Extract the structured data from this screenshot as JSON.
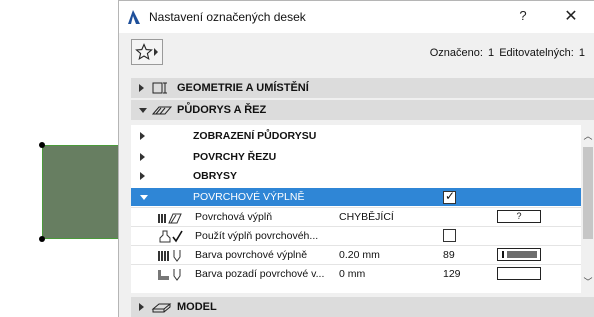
{
  "window": {
    "title": "Nastavení označených desek",
    "help_label": "?",
    "close_label": "✕"
  },
  "toolbar": {
    "selection_label": "Označeno:",
    "selection_count": "1",
    "editable_label": "Editovatelných:",
    "editable_count": "1"
  },
  "panels": [
    {
      "label": "GEOMETRIE A UMÍSTĚNÍ",
      "icon": "geometry-icon",
      "expanded": false
    },
    {
      "label": "PŮDORYS A ŘEZ",
      "icon": "floorplan-section-icon",
      "expanded": true
    },
    {
      "label": "MODEL",
      "icon": "model-icon",
      "expanded": false
    }
  ],
  "tree": {
    "groups": [
      {
        "label": "ZOBRAZENÍ PŮDORYSU"
      },
      {
        "label": "POVRCHY ŘEZU"
      },
      {
        "label": "OBRYSY"
      },
      {
        "label": "POVRCHOVÉ VÝPLNĚ",
        "checked": true
      }
    ],
    "rows": [
      {
        "icon": "fill-type-icon",
        "name": "Povrchová výplň",
        "value": "CHYBĚJÍCÍ",
        "number": "",
        "field": "?"
      },
      {
        "icon": "use-fill-icon",
        "name": "Použít výplň povrchovéh...",
        "value": "",
        "number": "",
        "checked": false
      },
      {
        "icon": "pen-color-icon",
        "name": "Barva povrchové výplně",
        "value": "0.20 mm",
        "number": "89",
        "field": ""
      },
      {
        "icon": "background-color-icon",
        "name": "Barva pozadí povrchové v...",
        "value": "0 mm",
        "number": "129",
        "field": ""
      }
    ]
  },
  "colors": {
    "selection": "#2f86d6",
    "slab_fill": "#677e61",
    "header_bg": "#dcdcdc"
  }
}
